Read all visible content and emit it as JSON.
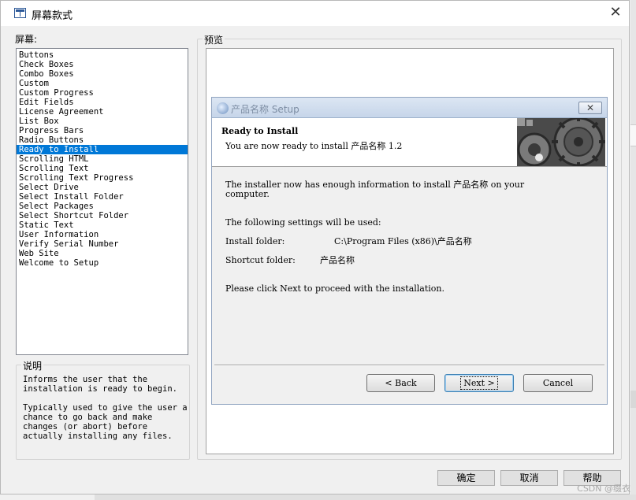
{
  "window": {
    "title": "屏幕款式",
    "close_glyph": "✕"
  },
  "screens": {
    "label": "屏幕:",
    "items": [
      "Buttons",
      "Check Boxes",
      "Combo Boxes",
      "Custom",
      "Custom Progress",
      "Edit Fields",
      "License Agreement",
      "List Box",
      "Progress Bars",
      "Radio Buttons",
      "Ready to Install",
      "Scrolling HTML",
      "Scrolling Text",
      "Scrolling Text Progress",
      "Select Drive",
      "Select Install Folder",
      "Select Packages",
      "Select Shortcut Folder",
      "Static Text",
      "User Information",
      "Verify Serial Number",
      "Web Site",
      "Welcome to Setup"
    ],
    "selected": "Ready to Install"
  },
  "description": {
    "label": "说明",
    "para1": "Informs the user that the\ninstallation is ready to begin.",
    "para2": "Typically used to give the user a\nchance to go back and make\nchanges (or abort) before\nactually installing any files."
  },
  "preview": {
    "label": "预览",
    "dialog": {
      "title": "产品名称 Setup",
      "close_glyph": "✕",
      "header_title": "Ready to Install",
      "header_subtitle": "You are now ready to install 产品名称 1.2",
      "intro": "The installer now has enough information to install 产品名称 on your\ncomputer.",
      "settings_intro": "The following settings will be used:",
      "install_folder_label": "Install folder:",
      "install_folder_value": "C:\\Program Files (x86)\\产品名称",
      "shortcut_folder_label": "Shortcut folder:",
      "shortcut_folder_value": "产品名称",
      "proceed": "Please click Next to proceed with the installation.",
      "back_label": "< Back",
      "next_label": "Next >",
      "cancel_label": "Cancel"
    }
  },
  "footer": {
    "ok_label": "确定",
    "cancel_label": "取消",
    "help_label": "帮助"
  },
  "watermark": "CSDN @缀衣",
  "colors": {
    "selection": "#0078d7",
    "dialog_title": "#c6d5e9"
  }
}
